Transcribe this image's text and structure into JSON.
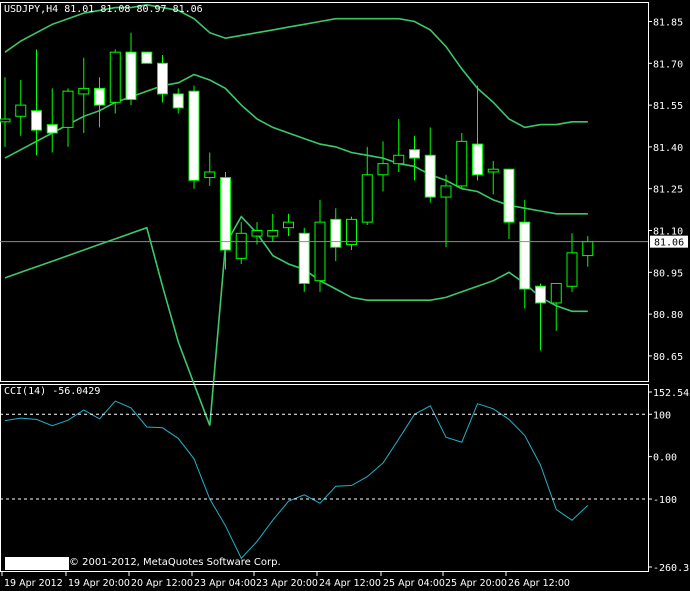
{
  "window": {
    "title": "USDJPY,H4",
    "ohlc": "81.01 81.08 80.97 81.06",
    "copyright": "© 2001-2012, MetaQuotes Software Corp."
  },
  "colors": {
    "background": "#000000",
    "candle_up_fill": "#000000",
    "candle_down_fill": "#ffffff",
    "candle_outline": "#00ff00",
    "bollinger": "#3cc86a",
    "cci_line": "#20b2c8",
    "grid": "#ffffff",
    "text": "#ffffff"
  },
  "chart_data": [
    {
      "type": "candlestick",
      "title": "USDJPY,H4",
      "indicator": "Bollinger Bands",
      "ylim": [
        80.56,
        81.92
      ],
      "y_ticks": [
        "81.85",
        "81.70",
        "81.55",
        "81.40",
        "81.25",
        "81.10",
        "80.95",
        "80.80",
        "80.65"
      ],
      "current_price": "81.06",
      "x_ticks": [
        "19 Apr 2012",
        "19 Apr 20:00",
        "20 Apr 12:00",
        "23 Apr 04:00",
        "23 Apr 20:00",
        "24 Apr 12:00",
        "25 Apr 04:00",
        "25 Apr 20:00",
        "26 Apr 12:00"
      ],
      "candles": [
        {
          "o": 81.49,
          "h": 81.65,
          "l": 81.4,
          "c": 81.5
        },
        {
          "o": 81.51,
          "h": 81.64,
          "l": 81.44,
          "c": 81.55
        },
        {
          "o": 81.53,
          "h": 81.75,
          "l": 81.37,
          "c": 81.46
        },
        {
          "o": 81.48,
          "h": 81.61,
          "l": 81.38,
          "c": 81.45
        },
        {
          "o": 81.47,
          "h": 81.61,
          "l": 81.4,
          "c": 81.6
        },
        {
          "o": 81.59,
          "h": 81.72,
          "l": 81.45,
          "c": 81.61
        },
        {
          "o": 81.61,
          "h": 81.65,
          "l": 81.47,
          "c": 81.55
        },
        {
          "o": 81.56,
          "h": 81.75,
          "l": 81.52,
          "c": 81.74
        },
        {
          "o": 81.74,
          "h": 81.81,
          "l": 81.55,
          "c": 81.57
        },
        {
          "o": 81.74,
          "h": 81.74,
          "l": 81.7,
          "c": 81.7
        },
        {
          "o": 81.7,
          "h": 81.73,
          "l": 81.56,
          "c": 81.59
        },
        {
          "o": 81.59,
          "h": 81.61,
          "l": 81.52,
          "c": 81.54
        },
        {
          "o": 81.6,
          "h": 81.62,
          "l": 81.25,
          "c": 81.28
        },
        {
          "o": 81.29,
          "h": 81.38,
          "l": 81.26,
          "c": 81.31
        },
        {
          "o": 81.29,
          "h": 81.31,
          "l": 80.96,
          "c": 81.03
        },
        {
          "o": 81.0,
          "h": 81.13,
          "l": 80.98,
          "c": 81.09
        },
        {
          "o": 81.08,
          "h": 81.13,
          "l": 81.05,
          "c": 81.1
        },
        {
          "o": 81.08,
          "h": 81.16,
          "l": 81.06,
          "c": 81.1
        },
        {
          "o": 81.11,
          "h": 81.16,
          "l": 81.08,
          "c": 81.13
        },
        {
          "o": 81.09,
          "h": 81.11,
          "l": 80.88,
          "c": 80.91
        },
        {
          "o": 80.92,
          "h": 81.21,
          "l": 80.88,
          "c": 81.13
        },
        {
          "o": 81.14,
          "h": 81.18,
          "l": 80.99,
          "c": 81.04
        },
        {
          "o": 81.05,
          "h": 81.15,
          "l": 81.03,
          "c": 81.14
        },
        {
          "o": 81.13,
          "h": 81.4,
          "l": 81.12,
          "c": 81.3
        },
        {
          "o": 81.3,
          "h": 81.42,
          "l": 81.24,
          "c": 81.34
        },
        {
          "o": 81.34,
          "h": 81.5,
          "l": 81.31,
          "c": 81.37
        },
        {
          "o": 81.39,
          "h": 81.44,
          "l": 81.28,
          "c": 81.36
        },
        {
          "o": 81.37,
          "h": 81.47,
          "l": 81.2,
          "c": 81.22
        },
        {
          "o": 81.22,
          "h": 81.3,
          "l": 81.04,
          "c": 81.26
        },
        {
          "o": 81.26,
          "h": 81.45,
          "l": 81.25,
          "c": 81.42
        },
        {
          "o": 81.41,
          "h": 81.62,
          "l": 81.28,
          "c": 81.3
        },
        {
          "o": 81.31,
          "h": 81.35,
          "l": 81.23,
          "c": 81.32
        },
        {
          "o": 81.32,
          "h": 81.32,
          "l": 81.07,
          "c": 81.13
        },
        {
          "o": 81.13,
          "h": 81.21,
          "l": 80.82,
          "c": 80.89
        },
        {
          "o": 80.9,
          "h": 80.91,
          "l": 80.67,
          "c": 80.84
        },
        {
          "o": 80.84,
          "h": 80.91,
          "l": 80.74,
          "c": 80.91
        },
        {
          "o": 80.9,
          "h": 81.09,
          "l": 80.88,
          "c": 81.02
        },
        {
          "o": 81.01,
          "h": 81.08,
          "l": 80.97,
          "c": 81.06
        }
      ],
      "bands": {
        "upper": [
          81.74,
          81.78,
          81.81,
          81.84,
          81.86,
          81.88,
          81.89,
          81.9,
          81.9,
          81.91,
          81.9,
          81.89,
          81.86,
          81.81,
          81.79,
          81.8,
          81.81,
          81.82,
          81.83,
          81.84,
          81.85,
          81.86,
          81.86,
          81.86,
          81.86,
          81.86,
          81.85,
          81.82,
          81.76,
          81.68,
          81.61,
          81.56,
          81.5,
          81.47,
          81.48,
          81.48,
          81.49,
          81.49
        ],
        "middle": [
          81.36,
          81.39,
          81.42,
          81.45,
          81.48,
          81.51,
          81.53,
          81.56,
          81.58,
          81.6,
          81.62,
          81.63,
          81.66,
          81.64,
          81.61,
          81.55,
          81.5,
          81.47,
          81.45,
          81.43,
          81.41,
          81.4,
          81.38,
          81.37,
          81.36,
          81.34,
          81.33,
          81.3,
          81.28,
          81.25,
          81.24,
          81.21,
          81.19,
          81.18,
          81.17,
          81.16,
          81.16,
          81.16
        ],
        "lower": [
          80.93,
          80.95,
          80.97,
          80.99,
          81.01,
          81.03,
          81.05,
          81.07,
          81.09,
          81.11,
          80.9,
          80.7,
          80.55,
          80.4,
          81.05,
          81.15,
          81.09,
          81.01,
          80.98,
          80.96,
          80.92,
          80.89,
          80.86,
          80.85,
          80.85,
          80.85,
          80.85,
          80.85,
          80.86,
          80.88,
          80.9,
          80.92,
          80.95,
          80.91,
          80.86,
          80.83,
          80.81,
          80.81
        ]
      }
    },
    {
      "type": "line",
      "title": "CCI(14)",
      "current_value": "-56.0429",
      "ylim": [
        -260.3164,
        152.5452
      ],
      "y_ticks": [
        "152.5452",
        "100",
        "0.00",
        "-100",
        "-260.3164"
      ],
      "levels": [
        100,
        -100
      ],
      "x_ticks": [
        "19 Apr 2012",
        "19 Apr 20:00",
        "20 Apr 12:00",
        "23 Apr 04:00",
        "23 Apr 20:00",
        "24 Apr 12:00",
        "25 Apr 04:00",
        "25 Apr 20:00",
        "26 Apr 12:00"
      ],
      "series": [
        {
          "values": [
            85,
            91,
            88,
            73,
            86,
            110,
            89,
            131,
            115,
            70,
            68,
            43,
            -5,
            -100,
            -163,
            -240,
            -200,
            -150,
            -105,
            -90,
            -110,
            -70,
            -68,
            -47,
            -15,
            42,
            100,
            120,
            46,
            34,
            125,
            113,
            88,
            50,
            -20,
            -125,
            -150,
            -115
          ]
        }
      ]
    }
  ]
}
